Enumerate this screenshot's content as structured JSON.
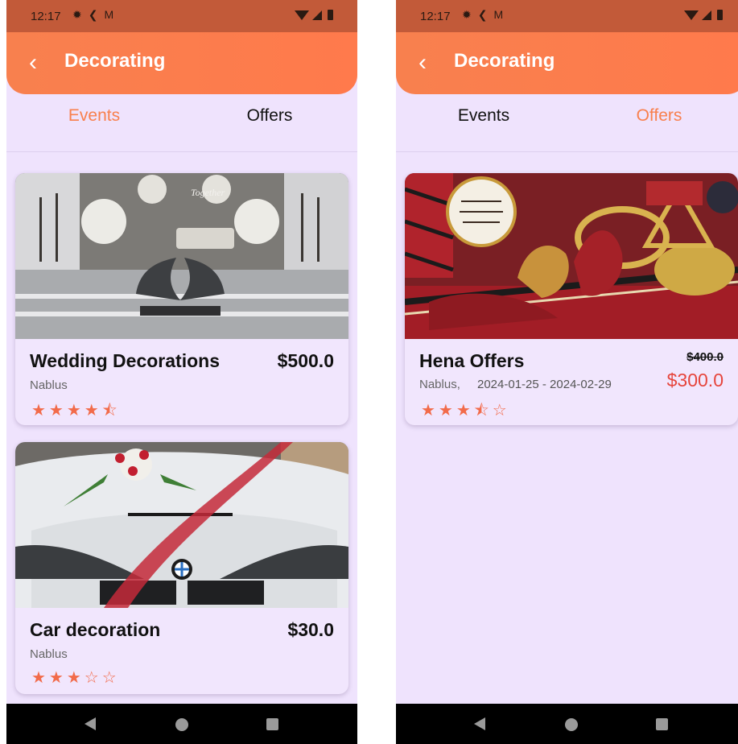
{
  "status": {
    "time": "12:17",
    "icons": [
      "settings-gear-icon",
      "assistant-icon",
      "gmail-icon",
      "wifi-icon",
      "cell-signal-icon",
      "battery-icon"
    ]
  },
  "colors": {
    "accent": "#f8804e",
    "star": "#f26b4a",
    "sale": "#e6453c",
    "background": "#efe3fd",
    "statusbar": "#c25a39"
  },
  "appbar": {
    "title": "Decorating",
    "back_icon": "chevron-left-icon"
  },
  "tabs": {
    "events": "Events",
    "offers": "Offers"
  },
  "screens": [
    {
      "active_tab": "Events",
      "cards": [
        {
          "name": "Wedding Decorations",
          "price": "$500.0",
          "location": "Nablus",
          "rating": 4.5,
          "stars": "★★★★⯪"
        },
        {
          "name": "Car decoration",
          "price": "$30.0",
          "location": "Nablus",
          "rating": 3,
          "stars": "★★★☆☆"
        }
      ]
    },
    {
      "active_tab": "Offers",
      "cards": [
        {
          "name": "Hena Offers",
          "old_price": "$400.0",
          "new_price": "$300.0",
          "location": "Nablus,",
          "dates": "2024-01-25 - 2024-02-29",
          "rating": 3.5,
          "stars": "★★★⯪☆"
        }
      ]
    }
  ]
}
